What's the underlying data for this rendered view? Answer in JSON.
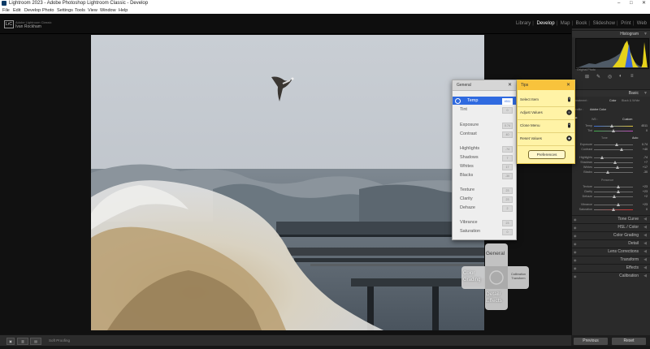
{
  "window": {
    "title": "Lightroom 2023 - Adobe Photoshop Lightroom Classic - Develop",
    "controls": [
      "–",
      "□",
      "✕"
    ]
  },
  "menu": [
    "File",
    "Edit",
    "Develop",
    "Photo",
    "Settings",
    "Tools",
    "View",
    "Window",
    "Help"
  ],
  "identity": {
    "badge": "LrC",
    "line1": "Adobe Lightroom Classic",
    "line2": "Ivan Rockham"
  },
  "modules": [
    {
      "label": "Library",
      "active": false
    },
    {
      "label": "Develop",
      "active": true
    },
    {
      "label": "Map",
      "active": false
    },
    {
      "label": "Book",
      "active": false
    },
    {
      "label": "Slideshow",
      "active": false
    },
    {
      "label": "Print",
      "active": false
    },
    {
      "label": "Web",
      "active": false
    }
  ],
  "right_panel": {
    "histogram_label": "Histogram",
    "histogram_footer": "Original Photo",
    "basic_label": "Basic",
    "treatment": {
      "label": "Treatment :",
      "color": "Color",
      "bw": "Black & White"
    },
    "profile": {
      "label": "Profile :",
      "value": "Adobe Color"
    },
    "wb": {
      "label": "WB :",
      "value": "Custom"
    },
    "tone_header": "Tone",
    "tone_auto": "Auto",
    "presence_header": "Presence",
    "sliders": [
      {
        "label": "Temp",
        "value": "4511"
      },
      {
        "label": "Tint",
        "value": "0"
      },
      {
        "label": "Exposure",
        "value": "0.74"
      },
      {
        "label": "Contrast",
        "value": "+40"
      },
      {
        "label": "Highlights",
        "value": "-74"
      },
      {
        "label": "Shadows",
        "value": "+7"
      },
      {
        "label": "Whites",
        "value": "+17"
      },
      {
        "label": "Blacks",
        "value": "-30"
      },
      {
        "label": "Texture",
        "value": "+23"
      },
      {
        "label": "Clarity",
        "value": "+23"
      },
      {
        "label": "Dehaze",
        "value": "+2"
      },
      {
        "label": "Vibrance",
        "value": "+23"
      },
      {
        "label": "Saturation",
        "value": "0"
      }
    ],
    "collapsed_panels": [
      "Tone Curve",
      "HSL / Color",
      "Color Grading",
      "Detail",
      "Lens Corrections",
      "Transform",
      "Effects",
      "Calibration"
    ],
    "buttons": {
      "previous": "Previous",
      "reset": "Reset"
    }
  },
  "toolbar": {
    "soft_proofing": "Soft Proofing"
  },
  "general_panel": {
    "title": "General",
    "items": [
      {
        "label": "Temp",
        "value": "4511",
        "selected": true
      },
      {
        "label": "Tint",
        "value": "0"
      },
      {
        "label": "Exposure",
        "value": "0.74"
      },
      {
        "label": "Contrast",
        "value": "40"
      },
      {
        "label": "Highlights",
        "value": "-74"
      },
      {
        "label": "Shadows",
        "value": "7"
      },
      {
        "label": "Whites",
        "value": "17"
      },
      {
        "label": "Blacks",
        "value": "-30"
      },
      {
        "label": "Texture",
        "value": "23"
      },
      {
        "label": "Clarity",
        "value": "23"
      },
      {
        "label": "Dehaze",
        "value": "2"
      },
      {
        "label": "Vibrance",
        "value": "23"
      },
      {
        "label": "Saturation",
        "value": "0"
      }
    ]
  },
  "tips_panel": {
    "title": "Tips",
    "rows": [
      {
        "label": "Select Item",
        "icon": "scroll-wheel-icon"
      },
      {
        "label": "Adjust Values",
        "icon": "dial-icon"
      },
      {
        "label": "Close Menu",
        "icon": "press-icon"
      },
      {
        "label": "Reset Values",
        "icon": "dial-press-icon"
      }
    ],
    "preferences": "Preferences"
  },
  "radial_menu": {
    "top": "General",
    "left": "Color Grading",
    "right": "Calibration Transform",
    "bottom": "Detail/ Effects"
  },
  "colors": {
    "accent_blue": "#2f6ae0",
    "tips_yellow": "#f8c33c",
    "tips_bg": "#fff3a6",
    "histogram_yellow": "#e6d21a"
  }
}
